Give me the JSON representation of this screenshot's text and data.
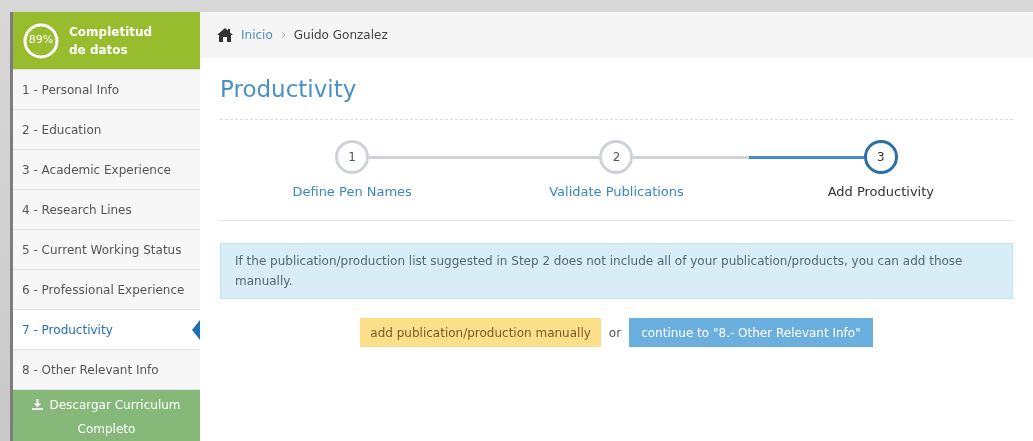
{
  "sidebar": {
    "completeness": {
      "percent": "89%",
      "title": [
        "Completitud",
        "de datos"
      ]
    },
    "items": [
      {
        "label": "1 - Personal Info",
        "selected": false
      },
      {
        "label": "2 - Education",
        "selected": false
      },
      {
        "label": "3 - Academic Experience",
        "selected": false
      },
      {
        "label": "4 - Research Lines",
        "selected": false
      },
      {
        "label": "5 - Current Working Status",
        "selected": false
      },
      {
        "label": "6 - Professional Experience",
        "selected": false
      },
      {
        "label": "7 - Productivity",
        "selected": true
      },
      {
        "label": "8 - Other Relevant Info",
        "selected": false
      }
    ],
    "download_button": {
      "label": "Descargar Curriculum Completo"
    }
  },
  "breadcrumb": [
    {
      "label": "Inicio",
      "link": true
    },
    {
      "label": "Guido Gonzalez",
      "link": false
    }
  ],
  "page_title": "Productivity",
  "steps": [
    {
      "number": "1",
      "label": "Define Pen Names",
      "selected": false
    },
    {
      "number": "2",
      "label": "Validate Publications",
      "selected": false
    },
    {
      "number": "3",
      "label": "Add Productivity",
      "selected": true
    }
  ],
  "info_message": "If the publication/production list suggested in Step 2 does not include all of your publication/products, you can add those manually.",
  "actions": {
    "add_button": "add publication/production manually",
    "separator": "or",
    "continue_button": "continue to \"8.- Other Relevant Info\""
  }
}
